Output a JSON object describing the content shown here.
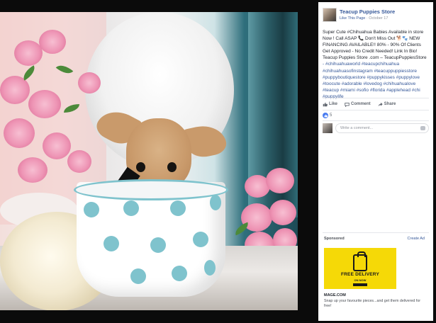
{
  "post": {
    "page_name": "Teacup Puppies Store",
    "like_link": "Like This Page",
    "dot": "·",
    "date": "October 17",
    "text_lines": [
      "Super Cute #Chihuahua Babies Available in store",
      "Now ! Call ASAP 📞 Don't Miss Out 🐕🐾 NEW",
      "FINANCING AVAILABLE!! 80% - 90% Of Clients",
      "Get Approved - No Credit Needed! Link In Bio!",
      "Teacup Puppies Store .com – TeacupPuppiesStore",
      "- #chihuahuaworld #teacupchihuahua",
      "#chihuahuasofinstagram #teacuppuppiesstore",
      "#puppyboutiquestore #puppykisses #puppylove",
      "#toocute #adorable #lovedog #chihuahualove",
      "#teacup #miami #sofio #florida #applehead #chi",
      "#puppylife"
    ]
  },
  "actions": {
    "like": "Like",
    "comment": "Comment",
    "share": "Share"
  },
  "reactions": {
    "count": "5"
  },
  "comment_box": {
    "placeholder": "Write a comment..."
  },
  "ad": {
    "sponsored_label": "Sponsored",
    "create_ad": "Create Ad",
    "image_title": "FREE DELIVERY",
    "image_subtitle": "ON NOW",
    "domain": "MAGE.COM",
    "description": "Snap up your favourite pieces...and get them delivered for free!"
  },
  "colors": {
    "link_blue": "#365899",
    "ad_yellow": "#f5d907",
    "cup_dots": "#7fc3cd",
    "background": "#0b0b0b"
  }
}
